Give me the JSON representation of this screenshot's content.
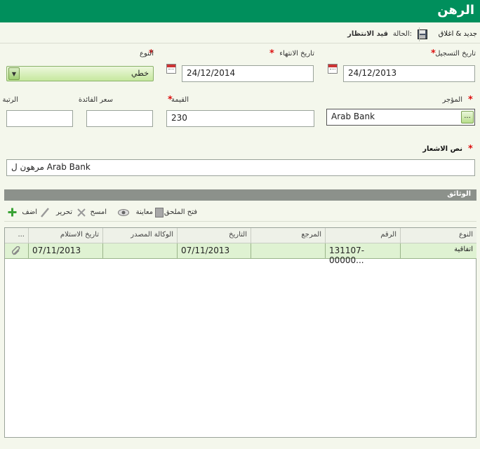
{
  "header": {
    "title": "الرهن"
  },
  "toolbar": {
    "save_close_label": "جديد & اغلاق",
    "status_label": "الحالة:",
    "status_value": "قيد الانتظار"
  },
  "form": {
    "registration_date": {
      "label": "تاريخ التسجيل",
      "value": "24/12/2013"
    },
    "expiry_date": {
      "label": "تاريخ الانتهاء",
      "value": "24/12/2014"
    },
    "type": {
      "label": "النوع",
      "value": "خطي"
    },
    "lessor": {
      "label": "المؤجر",
      "value": "Arab Bank",
      "button": "..."
    },
    "amount": {
      "label": "القيمة",
      "value": "230"
    },
    "interest_rate": {
      "label": "سعر الفائدة",
      "value": ""
    },
    "rank": {
      "label": "الرتبة",
      "value": ""
    },
    "notice_text": {
      "label": "نص الاشعار",
      "value": "مرهون ل Arab Bank"
    }
  },
  "documents": {
    "section_title": "الوثائق",
    "actions": {
      "open_attachment": "فتح الملحق",
      "preview": "معاينة",
      "delete": "امسح",
      "edit": "تحرير",
      "add": "اضف"
    },
    "columns": [
      "النوع",
      "الرقم",
      "المرجع",
      "التاريخ",
      "الوكالة المصدر",
      "تاريخ الاستلام",
      "..."
    ],
    "rows": [
      {
        "type": "اتفاقية",
        "number": "131107-00000...",
        "reference": "",
        "date": "07/11/2013",
        "agency": "",
        "received": "07/11/2013"
      }
    ]
  }
}
